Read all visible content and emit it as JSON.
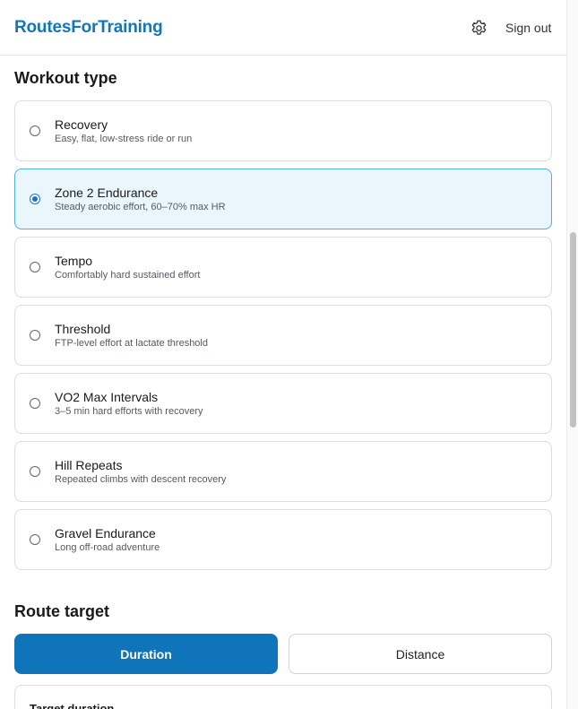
{
  "header": {
    "brand": "RoutesForTraining",
    "settings_icon": "gear-icon",
    "signout_label": "Sign out"
  },
  "workout_section": {
    "title": "Workout type",
    "selected": "Zone 2 Endurance",
    "options": [
      {
        "name": "Recovery",
        "description": "Easy, flat, low-stress ride or run"
      },
      {
        "name": "Zone 2 Endurance",
        "description": "Steady aerobic effort, 60–70% max HR"
      },
      {
        "name": "Tempo",
        "description": "Comfortably hard sustained effort"
      },
      {
        "name": "Threshold",
        "description": "FTP-level effort at lactate threshold"
      },
      {
        "name": "VO2 Max Intervals",
        "description": "3–5 min hard efforts with recovery"
      },
      {
        "name": "Hill Repeats",
        "description": "Repeated climbs with descent recovery"
      },
      {
        "name": "Gravel Endurance",
        "description": "Long off-road adventure"
      }
    ]
  },
  "route_target": {
    "title": "Route target",
    "duration_label": "Duration",
    "distance_label": "Distance",
    "active": "Duration",
    "target_duration_label": "Target duration"
  },
  "colors": {
    "brand": "#1277b8",
    "accent": "#0f74ba",
    "selected_bg": "#e9f6fc",
    "selected_border": "#4fb0de"
  }
}
